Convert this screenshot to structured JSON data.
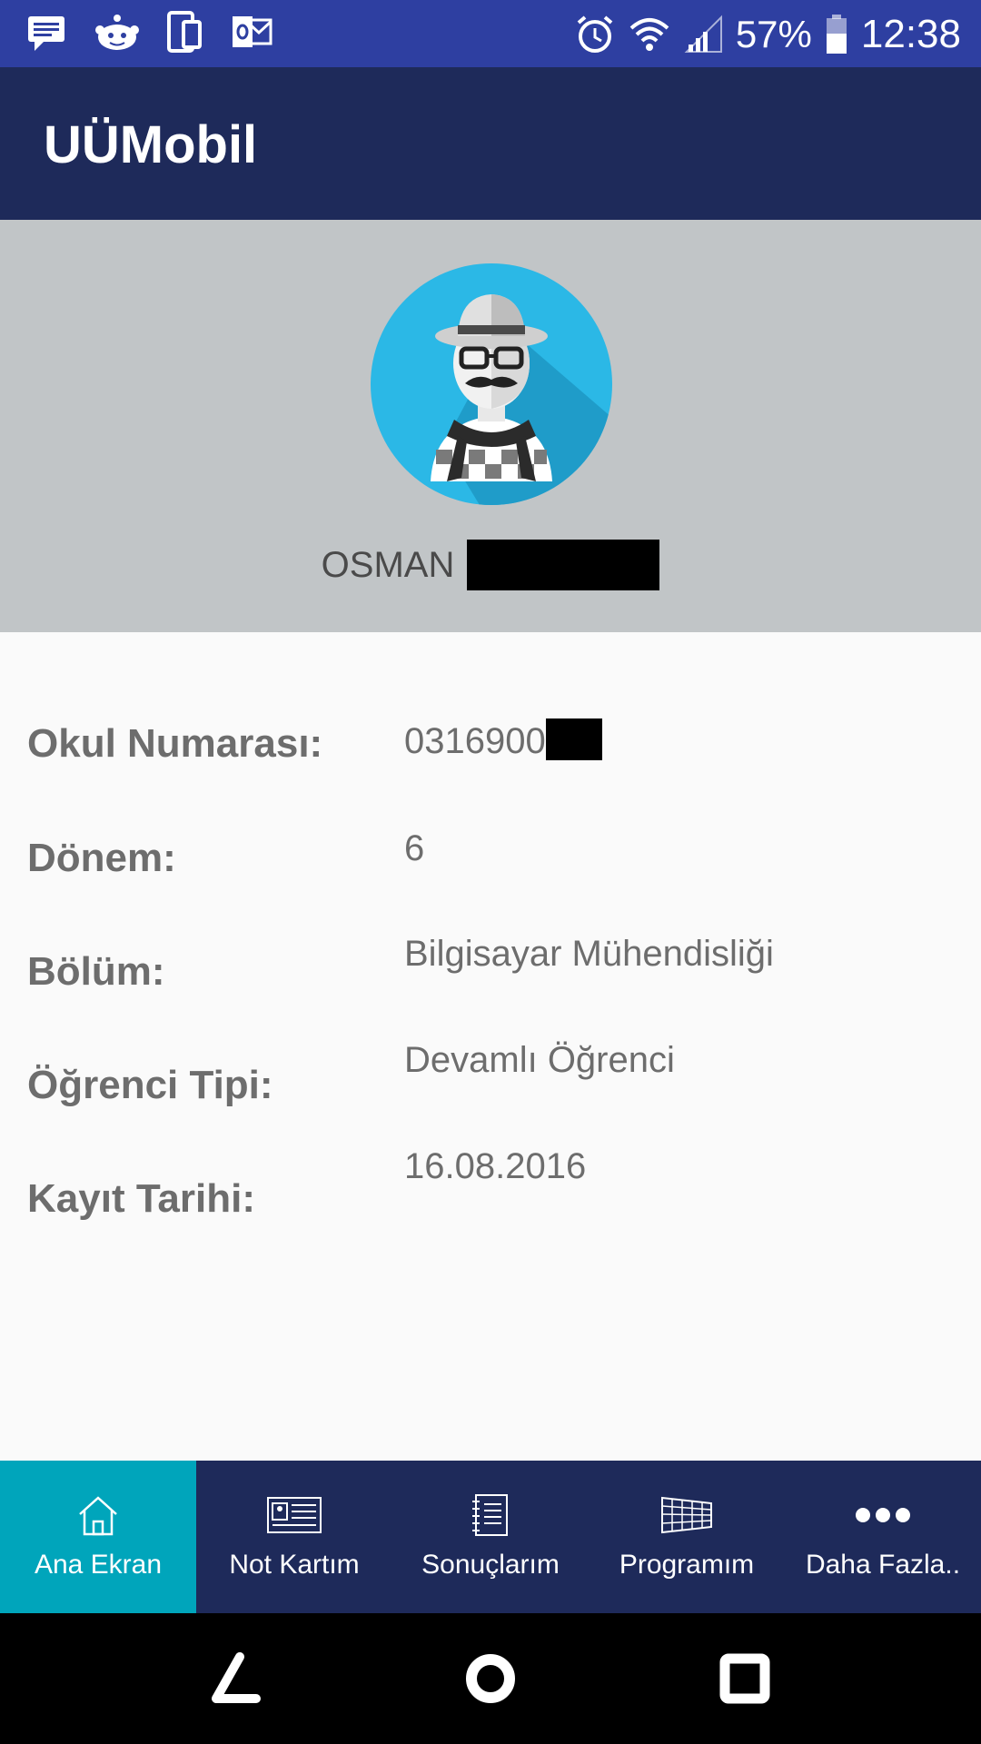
{
  "status_bar": {
    "icons_left": [
      "message-icon",
      "reddit-icon",
      "phone-link-icon",
      "outlook-icon"
    ],
    "icons_right": [
      "alarm-icon",
      "wifi-icon",
      "signal-icon"
    ],
    "battery": "57%",
    "time": "12:38",
    "bg_color": "#2e3fa1"
  },
  "app_bar": {
    "title": "UÜMobil",
    "bg_color": "#1e2a5a"
  },
  "profile": {
    "name": "OSMAN",
    "avatar_icon": "user-avatar-hipster",
    "bg_color": "#c1c5c7"
  },
  "info": {
    "items": [
      {
        "label": "Okul Numarası:",
        "value": "0316900"
      },
      {
        "label": "Dönem:",
        "value": "6"
      },
      {
        "label": "Bölüm:",
        "value": "Bilgisayar Mühendisliği"
      },
      {
        "label": "Öğrenci Tipi:",
        "value": "Devamlı Öğrenci"
      },
      {
        "label": "Kayıt Tarihi:",
        "value": "16.08.2016"
      }
    ]
  },
  "bottom_nav": {
    "active_color": "#00a5bb",
    "items": [
      {
        "label": "Ana Ekran",
        "icon": "home-icon"
      },
      {
        "label": "Not Kartım",
        "icon": "id-card-icon"
      },
      {
        "label": "Sonuçlarım",
        "icon": "notebook-icon"
      },
      {
        "label": "Programım",
        "icon": "schedule-grid-icon"
      },
      {
        "label": "Daha Fazla..",
        "icon": "more-dots-icon"
      }
    ]
  },
  "system_nav": {
    "buttons": [
      "back-icon",
      "home-circle-icon",
      "recents-icon"
    ]
  }
}
